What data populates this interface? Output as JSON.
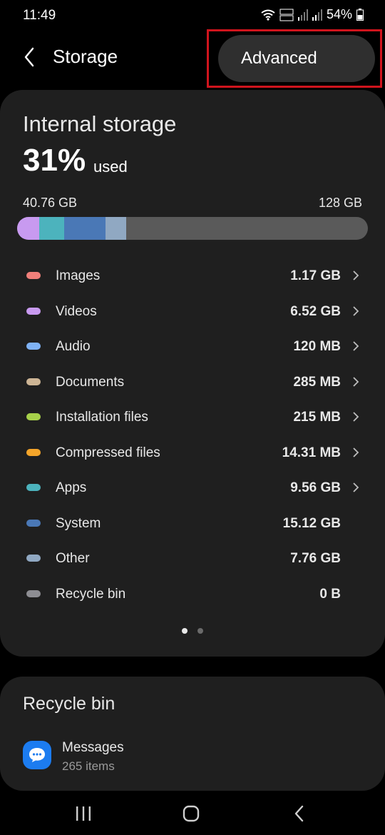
{
  "status": {
    "time": "11:49",
    "battery": "54%"
  },
  "header": {
    "title": "Storage"
  },
  "menu": {
    "advanced": "Advanced"
  },
  "storage": {
    "heading": "Internal storage",
    "percent": "31%",
    "used_word": "used",
    "used_size": "40.76 GB",
    "total_size": "128 GB",
    "bar_segments": [
      {
        "name": "Videos",
        "color": "#c89af0",
        "fraction": 0.062
      },
      {
        "name": "Apps",
        "color": "#4cb3bd",
        "fraction": 0.072
      },
      {
        "name": "System",
        "color": "#4a78b6",
        "fraction": 0.118
      },
      {
        "name": "Other",
        "color": "#90a8c2",
        "fraction": 0.06
      }
    ],
    "bar_free_color": "#5a5a5a"
  },
  "categories": [
    {
      "name": "Images",
      "size": "1.17 GB",
      "color": "#f07f7a",
      "chevron": true
    },
    {
      "name": "Videos",
      "size": "6.52 GB",
      "color": "#c89af0",
      "chevron": true
    },
    {
      "name": "Audio",
      "size": "120 MB",
      "color": "#7fb2f5",
      "chevron": true
    },
    {
      "name": "Documents",
      "size": "285 MB",
      "color": "#cdb595",
      "chevron": true
    },
    {
      "name": "Installation files",
      "size": "215 MB",
      "color": "#a7d14a",
      "chevron": true
    },
    {
      "name": "Compressed files",
      "size": "14.31 MB",
      "color": "#f5a52a",
      "chevron": true
    },
    {
      "name": "Apps",
      "size": "9.56 GB",
      "color": "#4cb3bd",
      "chevron": true
    },
    {
      "name": "System",
      "size": "15.12 GB",
      "color": "#4a78b6",
      "chevron": false
    },
    {
      "name": "Other",
      "size": "7.76 GB",
      "color": "#90a8c2",
      "chevron": false
    },
    {
      "name": "Recycle bin",
      "size": "0 B",
      "color": "#8e8e93",
      "chevron": false
    }
  ],
  "pager": {
    "active_color": "#e8e8e8",
    "inactive_color": "#6a6a6a"
  },
  "recycle_bin": {
    "heading": "Recycle bin",
    "app_name": "Messages",
    "item_count": "265 items"
  }
}
